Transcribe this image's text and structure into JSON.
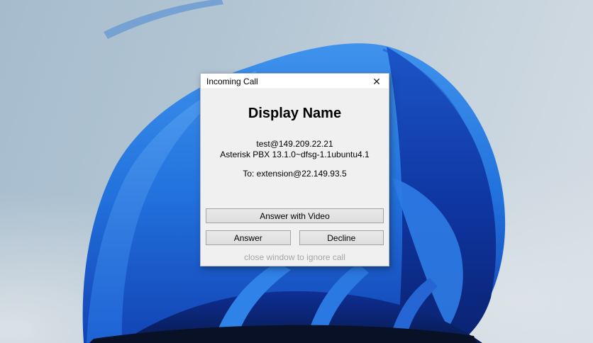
{
  "wallpaper": {
    "name": "windows-11-bloom",
    "sky_top": "#a6bccd",
    "sky_bottom": "#d5dde4",
    "bloom_bright": "#3f93ec",
    "bloom_mid": "#2272dd",
    "bloom_shadow": "#1243b4",
    "bloom_dark": "#0a2270",
    "bloom_deep": "#081126"
  },
  "dialog": {
    "title": "Incoming Call",
    "close_icon": "✕",
    "heading": "Display Name",
    "caller_uri": "test@149.209.22.21",
    "user_agent": "Asterisk PBX 13.1.0~dfsg-1.1ubuntu4.1",
    "to_line": "To: extension@22.149.93.5",
    "buttons": {
      "answer_with_video": "Answer with Video",
      "answer": "Answer",
      "decline": "Decline"
    },
    "footer_hint": "close window to ignore call"
  }
}
